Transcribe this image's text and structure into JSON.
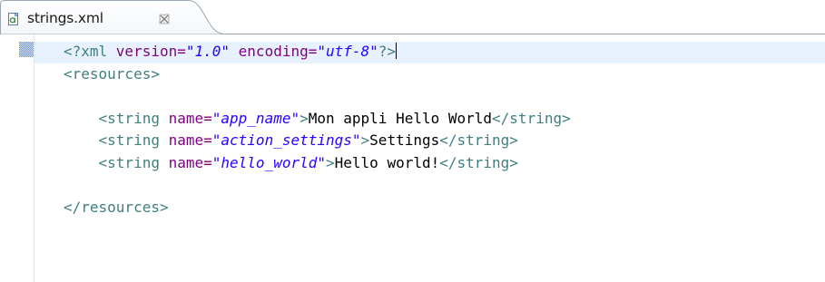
{
  "tab": {
    "title": "strings.xml",
    "icon": "xml-file-icon",
    "close_icon": "close-icon"
  },
  "editor": {
    "lines": [
      {
        "parts": [
          {
            "cls": "pi",
            "text": "<?xml "
          },
          {
            "cls": "attr",
            "text": "version="
          },
          {
            "cls": "val",
            "text": "\"1.0\""
          },
          {
            "cls": "attr",
            "text": " encoding="
          },
          {
            "cls": "val",
            "text": "\"utf-8\""
          },
          {
            "cls": "pi",
            "text": "?>"
          }
        ]
      },
      {
        "parts": [
          {
            "cls": "tag",
            "text": "<resources>"
          }
        ]
      },
      {
        "parts": []
      },
      {
        "parts": [
          {
            "cls": "tag",
            "text": "    <string "
          },
          {
            "cls": "attr",
            "text": "name="
          },
          {
            "cls": "val",
            "text": "\"app_name\""
          },
          {
            "cls": "tag",
            "text": ">"
          },
          {
            "cls": "txt",
            "text": "Mon appli Hello World"
          },
          {
            "cls": "tag",
            "text": "</string>"
          }
        ]
      },
      {
        "parts": [
          {
            "cls": "tag",
            "text": "    <string "
          },
          {
            "cls": "attr",
            "text": "name="
          },
          {
            "cls": "val",
            "text": "\"action_settings\""
          },
          {
            "cls": "tag",
            "text": ">"
          },
          {
            "cls": "txt",
            "text": "Settings"
          },
          {
            "cls": "tag",
            "text": "</string>"
          }
        ]
      },
      {
        "parts": [
          {
            "cls": "tag",
            "text": "    <string "
          },
          {
            "cls": "attr",
            "text": "name="
          },
          {
            "cls": "val",
            "text": "\"hello_world\""
          },
          {
            "cls": "tag",
            "text": ">"
          },
          {
            "cls": "txt",
            "text": "Hello world!"
          },
          {
            "cls": "tag",
            "text": "</string>"
          }
        ]
      },
      {
        "parts": []
      },
      {
        "parts": [
          {
            "cls": "tag",
            "text": "</resources>"
          }
        ]
      }
    ]
  },
  "colors": {
    "tag": "#3f7f7f",
    "attribute": "#7f007f",
    "value": "#2a00ff",
    "text": "#000000",
    "current_line": "#e8f2fe"
  }
}
